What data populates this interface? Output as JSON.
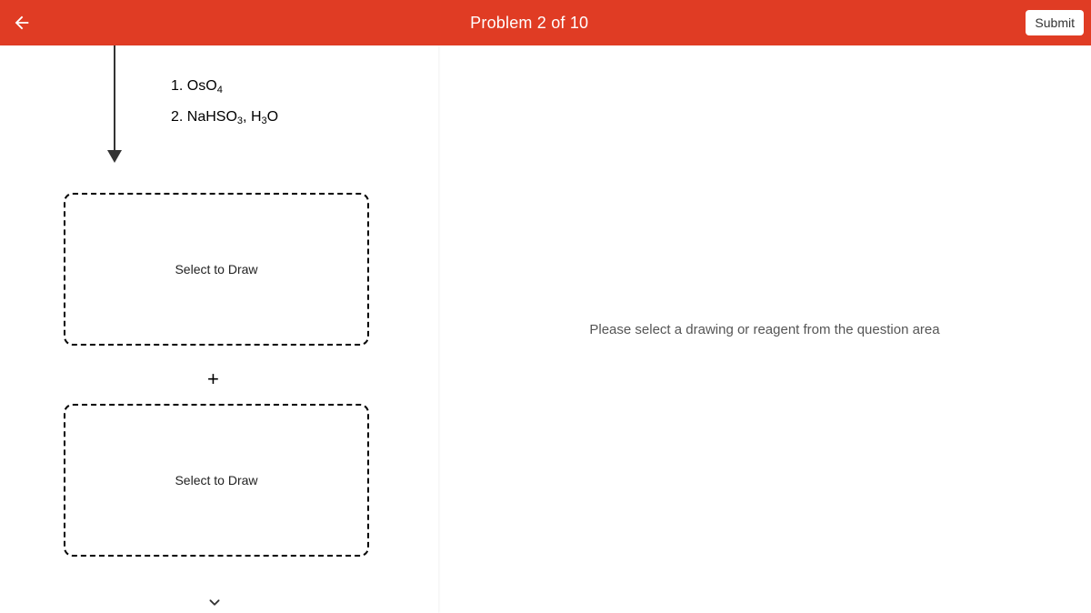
{
  "header": {
    "title": "Problem 2 of 10",
    "submit_label": "Submit"
  },
  "reagents": {
    "line1_prefix": "1. OsO",
    "line1_sub": "4",
    "line2_prefix": "2. NaHSO",
    "line2_sub1": "3",
    "line2_mid": ", H",
    "line2_sub2": "3",
    "line2_suffix": "O"
  },
  "boxes": {
    "box1_label": "Select to Draw",
    "plus": "+",
    "box2_label": "Select to Draw"
  },
  "right_panel": {
    "message": "Please select a drawing or reagent from the question area"
  }
}
